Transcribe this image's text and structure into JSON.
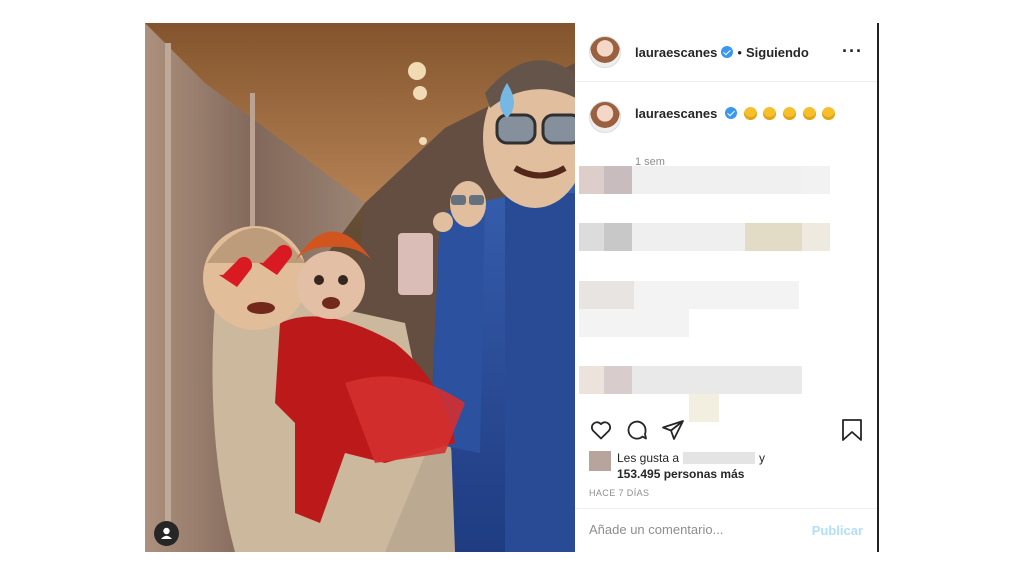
{
  "post": {
    "username": "lauraescanes",
    "follow_status": "Siguiendo",
    "separator": "•",
    "more_icon": "more-horizontal-icon",
    "caption_emojis": "😂😂😂😂😂",
    "caption_time": "1 sem",
    "likes_prefix": "Les gusta a",
    "likes_joiner": "y",
    "likes_count": "153.495 personas más",
    "date": "HACE 7 DÍAS",
    "comment_placeholder": "Añade un comentario...",
    "publish_label": "Publicar",
    "icons": [
      "heart-icon",
      "comment-icon",
      "share-icon",
      "bookmark-icon",
      "user-tag-icon"
    ],
    "colors": {
      "verified": "#3897f0",
      "publish_disabled": "#b2dffc",
      "secondary_text": "#8e8e8e"
    }
  }
}
